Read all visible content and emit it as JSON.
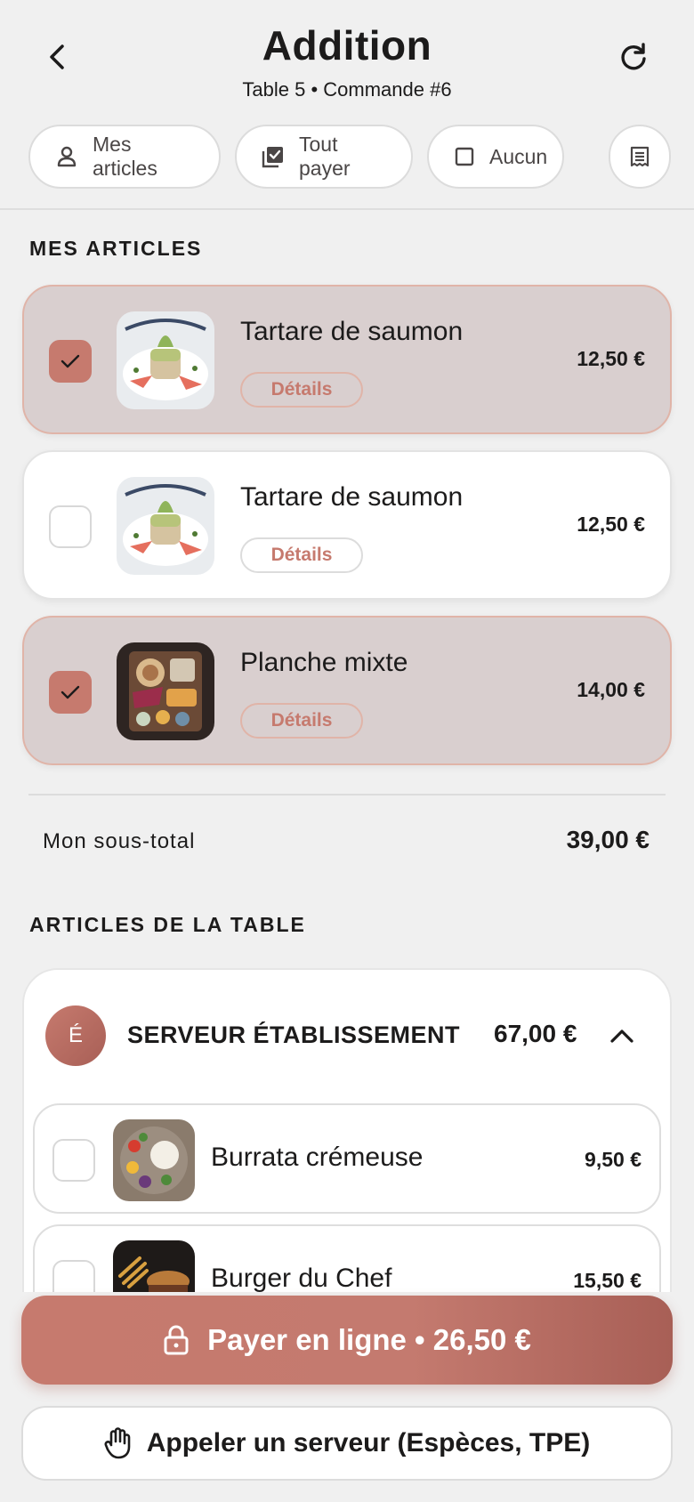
{
  "header": {
    "title": "Addition",
    "subtitle": "Table 5 • Commande #6",
    "back_icon": "chevron-left-icon",
    "refresh_icon": "refresh-icon"
  },
  "filters": {
    "mine_label": "Mes articles",
    "all_label": "Tout payer",
    "none_label": "Aucun",
    "receipt_icon": "receipt-icon"
  },
  "my_items": {
    "section_title": "MES ARTICLES",
    "details_label": "Détails",
    "items": [
      {
        "name": "Tartare de saumon",
        "price": "12,50 €",
        "selected": true
      },
      {
        "name": "Tartare de saumon",
        "price": "12,50 €",
        "selected": false
      },
      {
        "name": "Planche mixte",
        "price": "14,00 €",
        "selected": true
      }
    ],
    "subtotal_label": "Mon sous-total",
    "subtotal_value": "39,00 €"
  },
  "table_items": {
    "section_title": "ARTICLES DE LA TABLE",
    "group": {
      "avatar_initial": "É",
      "name": "SERVEUR ÉTABLISSEMENT",
      "total": "67,00 €",
      "expanded": true,
      "items": [
        {
          "name": "Burrata crémeuse",
          "price": "9,50 €",
          "selected": false
        },
        {
          "name": "Burger du Chef",
          "price": "15,50 €",
          "selected": false
        }
      ]
    }
  },
  "actions": {
    "pay_label": "Payer en ligne • 26,50 €",
    "call_label": "Appeler un serveur (Espèces, TPE)"
  },
  "colors": {
    "accent": "#c67a6e",
    "accent_dark": "#a85f56",
    "selected_bg": "#d9cfcf",
    "background": "#f0f0f0"
  }
}
